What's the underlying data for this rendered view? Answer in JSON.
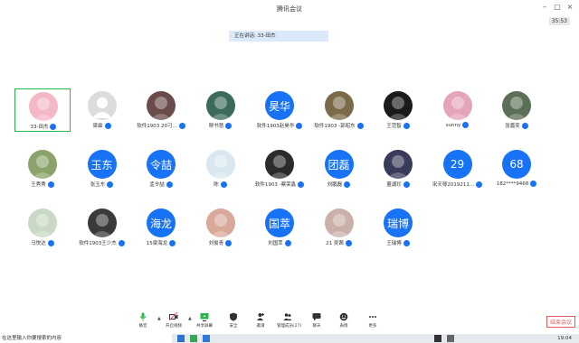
{
  "window": {
    "title": "腾讯会议",
    "timer": "35:53",
    "controls": {
      "minimize": "–",
      "restore": "□",
      "close": "×"
    }
  },
  "speaking": {
    "text": "正在讲话: 33-田杰"
  },
  "participants": [
    {
      "name": "33-田杰",
      "avatar_type": "photo",
      "avatar_color": "#f4b7c7",
      "active": true
    },
    {
      "name": "梁霖",
      "avatar_type": "default",
      "avatar_color": "#dcdcdc"
    },
    {
      "name": "软件1903 20刁...",
      "avatar_type": "photo",
      "avatar_color": "#6b4a4a"
    },
    {
      "name": "穆书慧",
      "avatar_type": "photo",
      "avatar_color": "#3c6b5a"
    },
    {
      "name": "软件1903赵昊华",
      "avatar_type": "text",
      "avatar_text": "昊华",
      "avatar_color": "#1772f6"
    },
    {
      "name": "软件1903 -郭昭东",
      "avatar_type": "photo",
      "avatar_color": "#7a6a4a"
    },
    {
      "name": "王范智",
      "avatar_type": "photo",
      "avatar_color": "#1a1a1a"
    },
    {
      "name": "sunny",
      "avatar_type": "photo",
      "avatar_color": "#e4a5b8"
    },
    {
      "name": "张嘉奕",
      "avatar_type": "photo",
      "avatar_color": "#5a6f55"
    },
    {
      "name": "王秀秀",
      "avatar_type": "photo",
      "avatar_color": "#8aa36a"
    },
    {
      "name": "张玉东",
      "avatar_type": "text",
      "avatar_text": "玉东",
      "avatar_color": "#1772f6"
    },
    {
      "name": "孟令喆",
      "avatar_type": "text",
      "avatar_text": "令喆",
      "avatar_color": "#1772f6"
    },
    {
      "name": "陈",
      "avatar_type": "photo",
      "avatar_color": "#d9e8f0"
    },
    {
      "name": "软件1903 -蔡荣鑫",
      "avatar_type": "photo",
      "avatar_color": "#2b2b2b"
    },
    {
      "name": "刘鹏磊",
      "avatar_type": "text",
      "avatar_text": "团磊",
      "avatar_color": "#1772f6"
    },
    {
      "name": "董湖珍",
      "avatar_type": "photo",
      "avatar_color": "#3a3a5a"
    },
    {
      "name": "宋天琴2019211...",
      "avatar_type": "text",
      "avatar_text": "29",
      "avatar_color": "#1772f6"
    },
    {
      "name": "182****9468",
      "avatar_type": "text",
      "avatar_text": "68",
      "avatar_color": "#1772f6"
    },
    {
      "name": "马悦达",
      "avatar_type": "photo",
      "avatar_color": "#c9d9c4"
    },
    {
      "name": "软件1903王少杰",
      "avatar_type": "photo",
      "avatar_color": "#3a3a3a"
    },
    {
      "name": "15梁海龙",
      "avatar_type": "text",
      "avatar_text": "海龙",
      "avatar_color": "#1772f6"
    },
    {
      "name": "刘俊青",
      "avatar_type": "photo",
      "avatar_color": "#d8a89a"
    },
    {
      "name": "刘国萃",
      "avatar_type": "text",
      "avatar_text": "国萃",
      "avatar_color": "#1772f6"
    },
    {
      "name": "21 吴茜",
      "avatar_type": "photo",
      "avatar_color": "#c9b1a9"
    },
    {
      "name": "王瑞博",
      "avatar_type": "text",
      "avatar_text": "瑞博",
      "avatar_color": "#1772f6"
    }
  ],
  "toolbar": {
    "items": [
      {
        "label": "静音",
        "icon": "microphone-icon",
        "color": "#27b44a"
      },
      {
        "label": "开启视频",
        "icon": "video-off-icon",
        "color": "#333333"
      },
      {
        "label": "共享屏幕",
        "icon": "share-screen-icon",
        "color": "#333333"
      },
      {
        "label": "安全",
        "icon": "shield-icon",
        "color": "#333333"
      },
      {
        "label": "邀请",
        "icon": "invite-icon",
        "color": "#333333"
      },
      {
        "label": "管理成员(27)",
        "icon": "members-icon",
        "color": "#333333"
      },
      {
        "label": "聊天",
        "icon": "chat-icon",
        "color": "#333333"
      },
      {
        "label": "表情",
        "icon": "emoji-icon",
        "color": "#333333"
      },
      {
        "label": "更多",
        "icon": "more-icon",
        "color": "#333333"
      }
    ],
    "end_meeting": "结束会议"
  },
  "taskbar": {
    "search_placeholder": "在这里输入你要搜索的内容",
    "clock": "19:04"
  }
}
